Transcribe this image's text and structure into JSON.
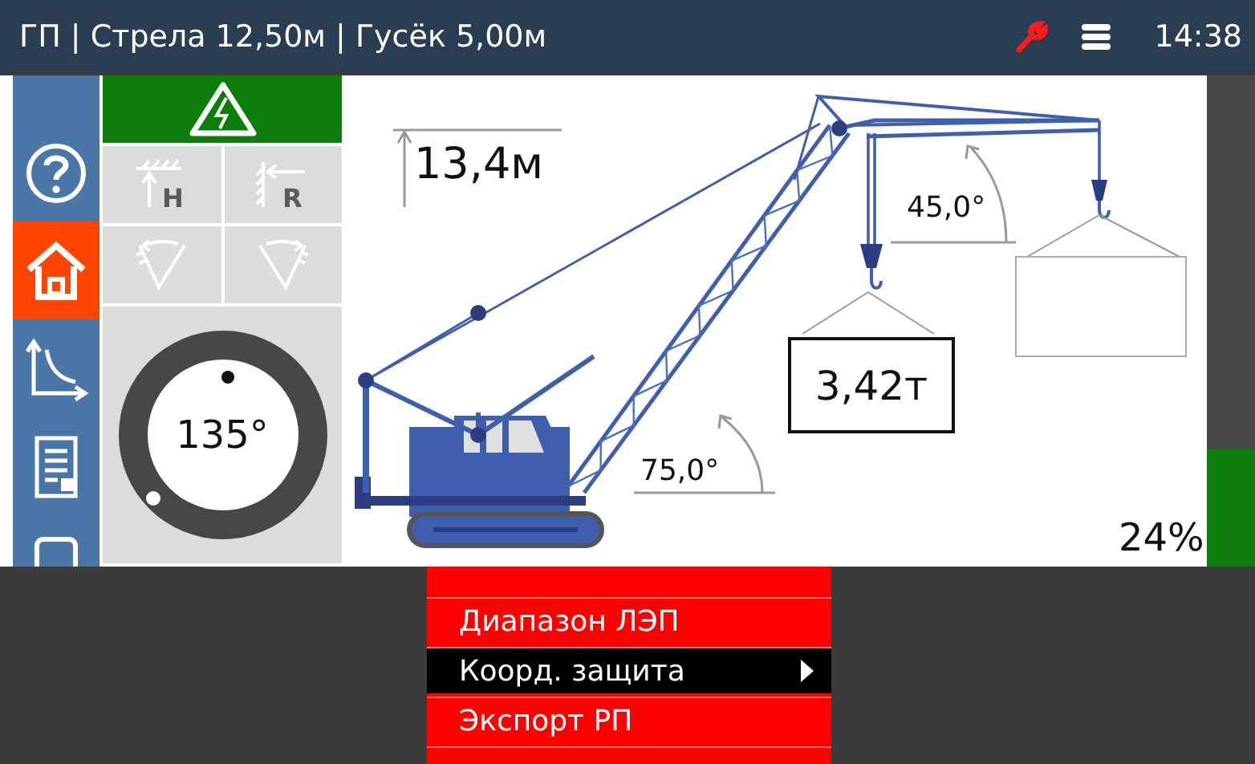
{
  "title_bar": {
    "title": "ГП | Стрела 12,50м | Гусёк 5,00м",
    "clock": "14:38"
  },
  "sidebar": {
    "items": [
      {
        "kind": "help",
        "selected": false
      },
      {
        "kind": "home",
        "selected": true
      },
      {
        "kind": "chart",
        "selected": false
      },
      {
        "kind": "report",
        "selected": false
      },
      {
        "kind": "other",
        "selected": false
      }
    ]
  },
  "power_line_button": {
    "on": true
  },
  "limit_buttons": [
    {
      "kind": "height",
      "label": "H"
    },
    {
      "kind": "radius",
      "label": "R"
    },
    {
      "kind": "angle_left"
    },
    {
      "kind": "angle_right"
    }
  ],
  "slew_dial": {
    "reading": "135°"
  },
  "crane": {
    "hook_height": "13,4м",
    "load": "3,42т",
    "boom_angle": "75,0°",
    "jib_angle": "45,0°"
  },
  "load_meter": {
    "level": 0.24,
    "reading": "24%"
  },
  "menu": {
    "items": [
      {
        "label": "Диапазон ЛЭП",
        "selected": false,
        "has_submenu": false
      },
      {
        "label": "Коорд. защита",
        "selected": true,
        "has_submenu": true
      },
      {
        "label": "Экспорт РП",
        "selected": false,
        "has_submenu": false
      },
      {
        "selected": false,
        "has_submenu": false
      }
    ]
  }
}
